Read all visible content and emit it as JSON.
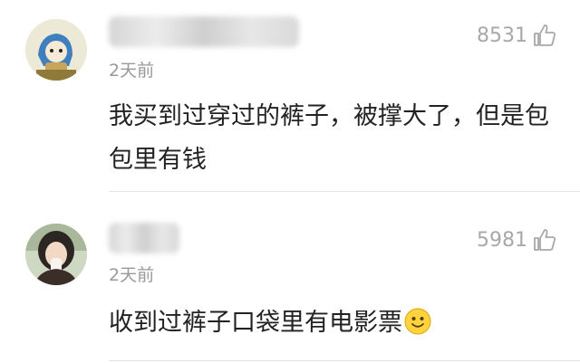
{
  "comments": [
    {
      "username": "",
      "time": "2天前",
      "likes": "8531",
      "content": "我买到过穿过的裤子，被撑大了，但是包包里有钱"
    },
    {
      "username": "",
      "time": "2天前",
      "likes": "5981",
      "content": "收到过裤子口袋里有电影票",
      "emoji": "smiley-emoji-icon"
    }
  ],
  "colors": {
    "text": "#222222",
    "meta": "#999999",
    "likes": "#a8a8a8",
    "divider": "#e3e3e3"
  }
}
